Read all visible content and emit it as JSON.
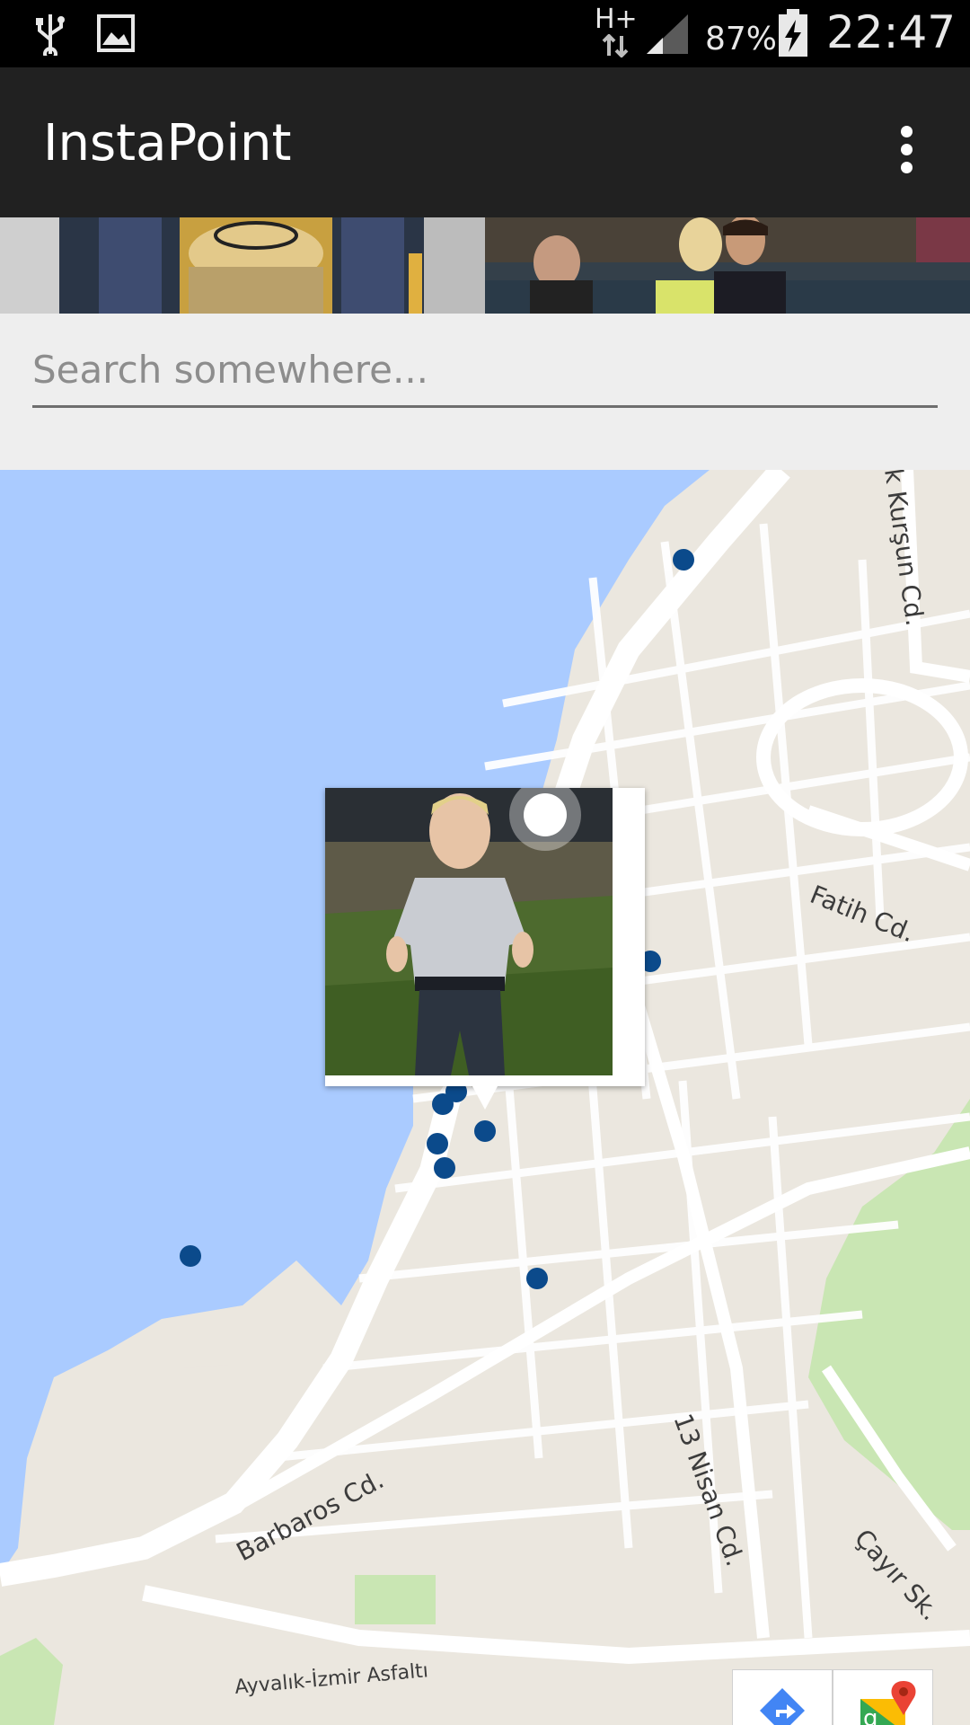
{
  "status_bar": {
    "network": "H+",
    "battery": "87%",
    "time": "22:47",
    "icons": [
      "usb-icon",
      "image-icon",
      "signal-icon",
      "battery-charging-icon"
    ]
  },
  "app_bar": {
    "title": "InstaPoint",
    "menu_icon": "overflow-menu-icon"
  },
  "search": {
    "placeholder": "Search somewhere..."
  },
  "map": {
    "streets": {
      "kursun": "k Kurşun Cd.",
      "fatih": "Fatih Cd.",
      "barbaros": "Barbaros Cd.",
      "nisan": "13 Nisan Cd.",
      "cayir": "Çayır Sk.",
      "asfalti": "Ayvalık-İzmir Asfaltı"
    },
    "marker_color": "#0b4a8b",
    "water_color": "#aacbff",
    "land_color": "#ebe7df",
    "buttons": [
      "directions-icon",
      "google-maps-icon"
    ]
  }
}
